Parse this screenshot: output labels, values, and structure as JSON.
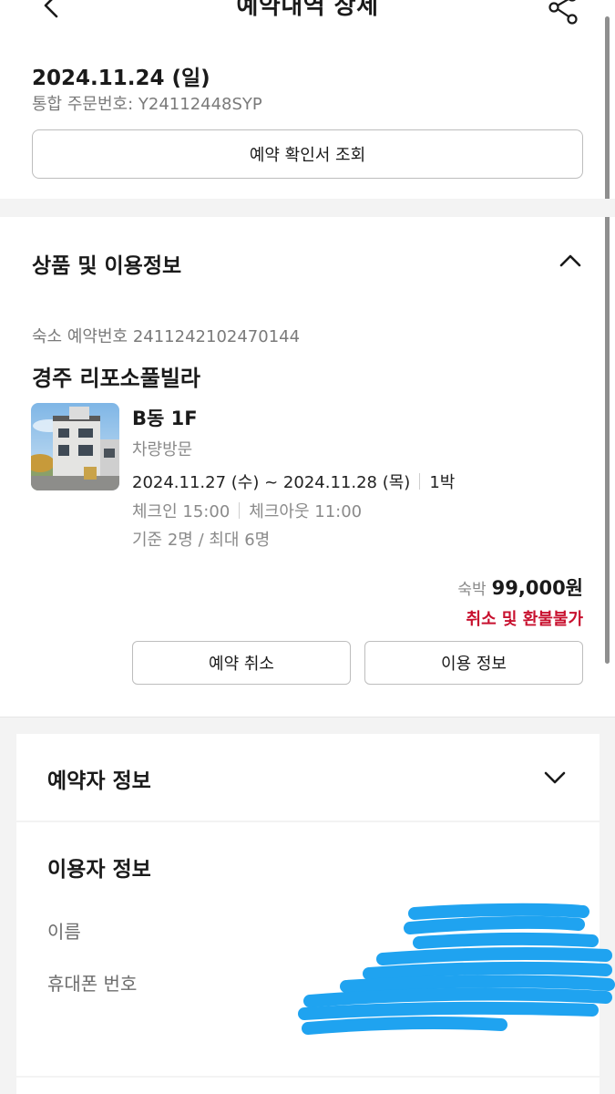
{
  "header": {
    "title": "예약내역 상세",
    "back_icon": "chevron-left-icon",
    "share_icon": "share-icon"
  },
  "order": {
    "date": "2024.11.24 (일)",
    "number_label": "통합 주문번호:",
    "number_value": "Y24112448SYP",
    "confirm_button": "예약 확인서 조회"
  },
  "product_section": {
    "title": "상품 및 이용정보",
    "expanded": true,
    "lodging_no_label": "숙소 예약번호",
    "lodging_no_value": "2411242102470144",
    "lodging_name": "경주 리포소풀빌라",
    "room": {
      "name": "B동 1F",
      "visit_type": "차량방문",
      "date_range": "2024.11.27 (수) ~ 2024.11.28 (목)",
      "nights": "1박",
      "checkin": "체크인 15:00",
      "checkout": "체크아웃 11:00",
      "capacity": "기준 2명 / 최대 6명"
    },
    "price_label": "숙박",
    "price_value": "99,000원",
    "refund_note": "취소 및 환불불가",
    "cancel_button": "예약 취소",
    "info_button": "이용 정보"
  },
  "booker_section": {
    "title": "예약자 정보",
    "expanded": false
  },
  "user_section": {
    "title": "이용자 정보",
    "name_label": "이름",
    "phone_label": "휴대폰 번호"
  },
  "colors": {
    "accent_red": "#c8102e",
    "redaction_blue": "#1fa3f0",
    "divider_gray": "#f3f3f3"
  }
}
